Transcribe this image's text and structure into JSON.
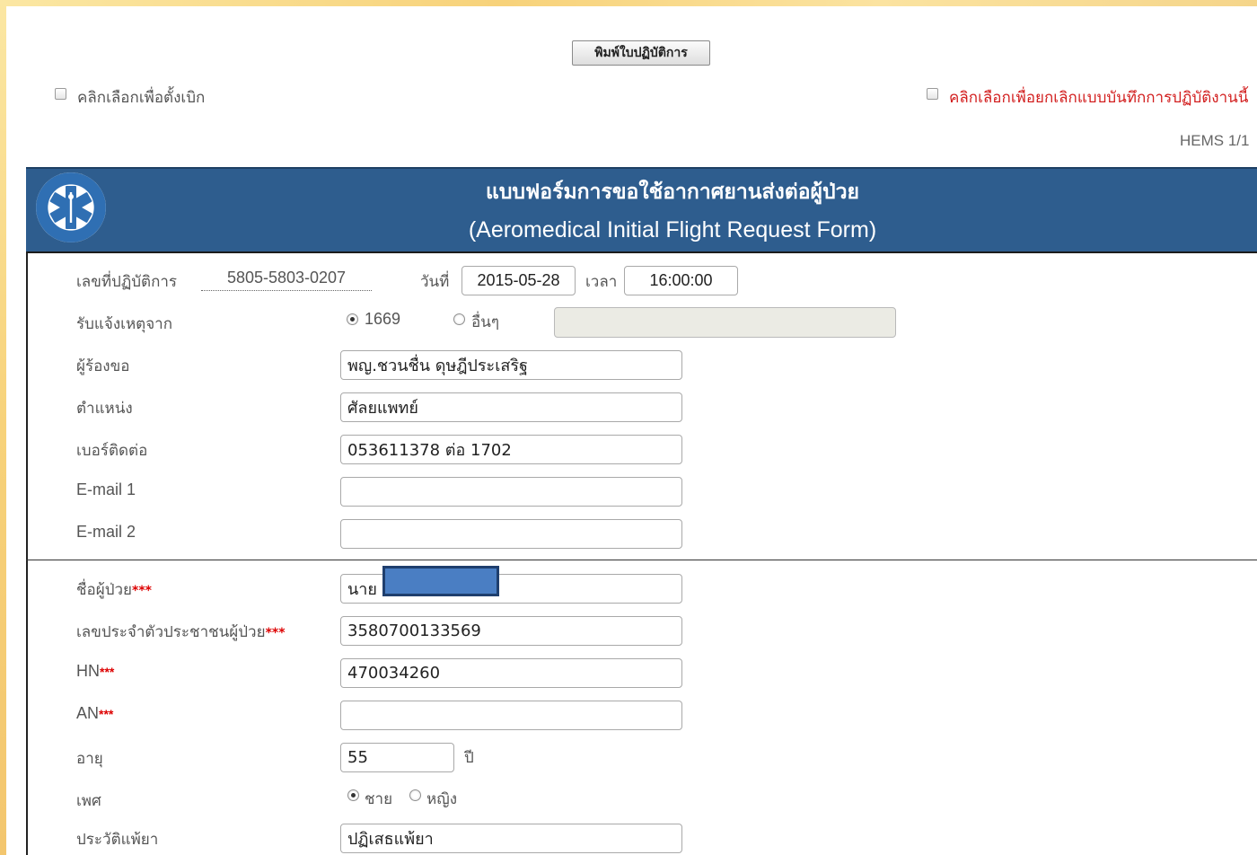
{
  "toolbar": {
    "print_label": "พิมพ์ใบปฏิบัติการ"
  },
  "options": {
    "withdraw_label": "คลิกเลือกเพื่อตั้งเบิก",
    "cancel_label": "คลิกเลือกเพื่อยกเลิกแบบบันทึกการปฏิบัติงานนี้"
  },
  "page_info": "HEMS 1/1",
  "header": {
    "title_th": "แบบฟอร์มการขอใช้อากาศยานส่งต่อผู้ป่วย",
    "title_en": "(Aeromedical Initial Flight Request Form)"
  },
  "request": {
    "op_number_label": "เลขที่ปฏิบัติการ",
    "op_number": "5805-5803-0207",
    "date_label": "วันที่",
    "date": "2015-05-28",
    "time_label": "เวลา",
    "time": "16:00:00",
    "source_label": "รับแจ้งเหตุจาก",
    "source_options": [
      "1669",
      "อื่นๆ"
    ],
    "source_other": "",
    "requester_label": "ผู้ร้องขอ",
    "requester": "พญ.ชวนชื่น  ดุษฎีประเสริฐ",
    "position_label": "ตำแหน่ง",
    "position": "ศัลยแพทย์",
    "phone_label": "เบอร์ติดต่อ",
    "phone": "053611378 ต่อ 1702",
    "email1_label": "E-mail 1",
    "email1": "",
    "email2_label": "E-mail 2",
    "email2": ""
  },
  "patient": {
    "required_mark": "***",
    "name_label": "ชื่อผู้ป่วย",
    "name": "นาย",
    "id_label": "เลขประจำตัวประชาชนผู้ป่วย",
    "id": "3580700133569",
    "hn_label": "HN",
    "hn": "470034260",
    "an_label": "AN",
    "an": "",
    "age_label": "อายุ",
    "age": "55",
    "age_unit": "ปี",
    "sex_label": "เพศ",
    "sex_options": [
      "ชาย",
      "หญิง"
    ],
    "allergy_label": "ประวัติแพ้ยา",
    "allergy": "ปฏิเสธแพ้ยา"
  }
}
